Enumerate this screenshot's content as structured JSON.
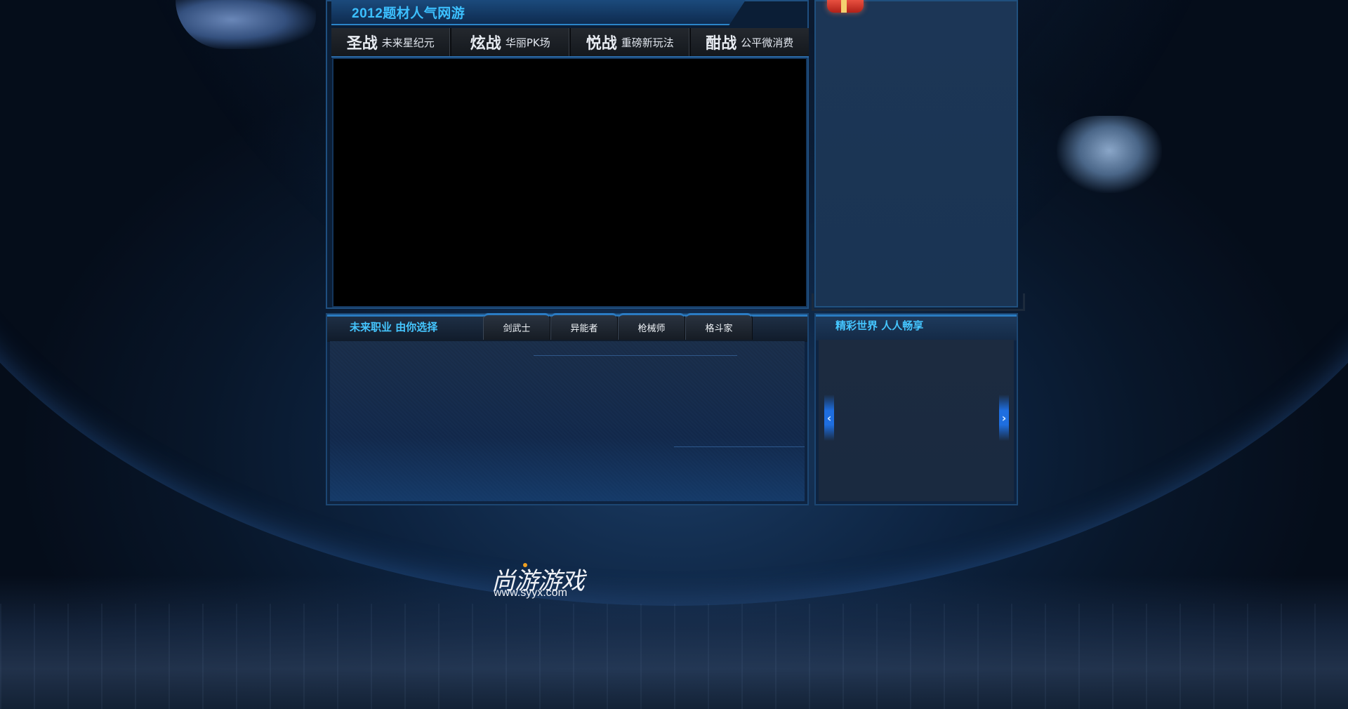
{
  "header": {
    "title": "2012题材人气网游"
  },
  "feature_tabs": [
    {
      "big": "圣战",
      "small": "未来星纪元"
    },
    {
      "big": "炫战",
      "small": "华丽PK场"
    },
    {
      "big": "悦战",
      "small": "重磅新玩法"
    },
    {
      "big": "酣战",
      "small": "公平微消费"
    }
  ],
  "career": {
    "title": "未来职业 由你选择",
    "tabs": [
      "剑武士",
      "异能者",
      "枪械师",
      "格斗家"
    ]
  },
  "world": {
    "title": "精彩世界 人人畅享",
    "prev_label": "‹",
    "next_label": "›"
  },
  "logo": {
    "name": "尚游游戏",
    "url": "www.syyx.com"
  },
  "colors": {
    "accent_cyan": "#3cc0ff",
    "panel_blue": "#1c3656",
    "background": "#050d1a"
  },
  "icons": {
    "gift": "gift-box-icon"
  }
}
